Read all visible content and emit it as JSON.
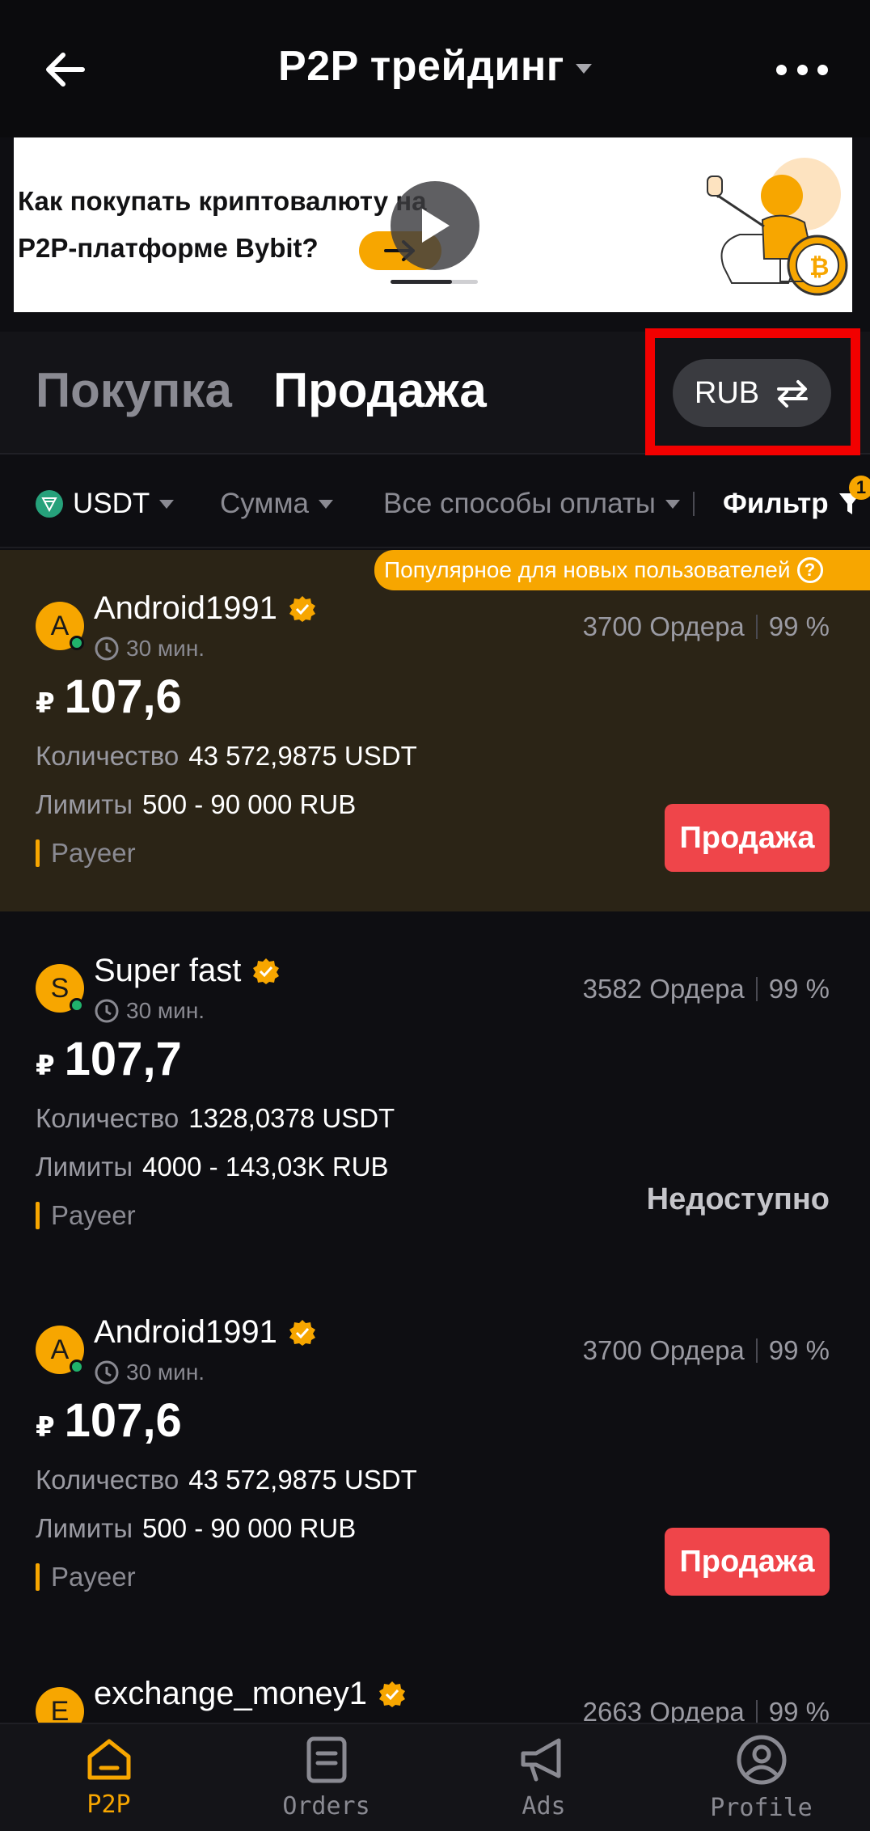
{
  "header": {
    "title": "P2P трейдинг"
  },
  "banner": {
    "line1": "Как покупать криптовалюту на",
    "line2": "P2P-платформе Bybit?",
    "progress": 0.7
  },
  "tabs": {
    "buy": "Покупка",
    "sell": "Продажа",
    "active": "sell"
  },
  "currency": "RUB",
  "filters": {
    "coin": "USDT",
    "amount": "Сумма",
    "payment": "Все способы оплаты",
    "filter": "Фильтр",
    "filter_count": "1"
  },
  "labels": {
    "quantity": "Количество",
    "limits": "Лимиты",
    "sell_button": "Продажа",
    "unavailable": "Недоступно",
    "promo": "Популярное для новых пользователей",
    "help": "?",
    "currency_symbol": "₽"
  },
  "offers": [
    {
      "avatar": "A",
      "merchant": "Android1991",
      "time": "30 мин.",
      "orders": "3700 Ордера",
      "completion": "99 %",
      "price": "107,6",
      "quantity": "43 572,9875 USDT",
      "limits": "500 - 90 000 RUB",
      "payment": "Payeer",
      "featured": true
    },
    {
      "avatar": "S",
      "merchant": "Super fast",
      "time": "30 мин.",
      "orders": "3582 Ордера",
      "completion": "99 %",
      "price": "107,7",
      "quantity": "1328,0378 USDT",
      "limits": "4000 - 143,03K RUB",
      "payment": "Payeer",
      "available": false
    },
    {
      "avatar": "A",
      "merchant": "Android1991",
      "time": "30 мин.",
      "orders": "3700 Ордера",
      "completion": "99 %",
      "price": "107,6",
      "quantity": "43 572,9875 USDT",
      "limits": "500 - 90 000 RUB",
      "payment": "Payeer"
    },
    {
      "avatar": "E",
      "merchant": "exchange_money1",
      "orders": "2663 Ордера",
      "completion": "99 %"
    }
  ],
  "bottom_nav": [
    {
      "label": "P2P",
      "icon": "home-icon",
      "active": true
    },
    {
      "label": "Orders",
      "icon": "document-icon"
    },
    {
      "label": "Ads",
      "icon": "megaphone-icon"
    },
    {
      "label": "Profile",
      "icon": "person-icon"
    }
  ],
  "colors": {
    "accent": "#f7a600",
    "sell": "#ef454a",
    "online": "#20b26c",
    "highlight_box": "#f20000"
  }
}
